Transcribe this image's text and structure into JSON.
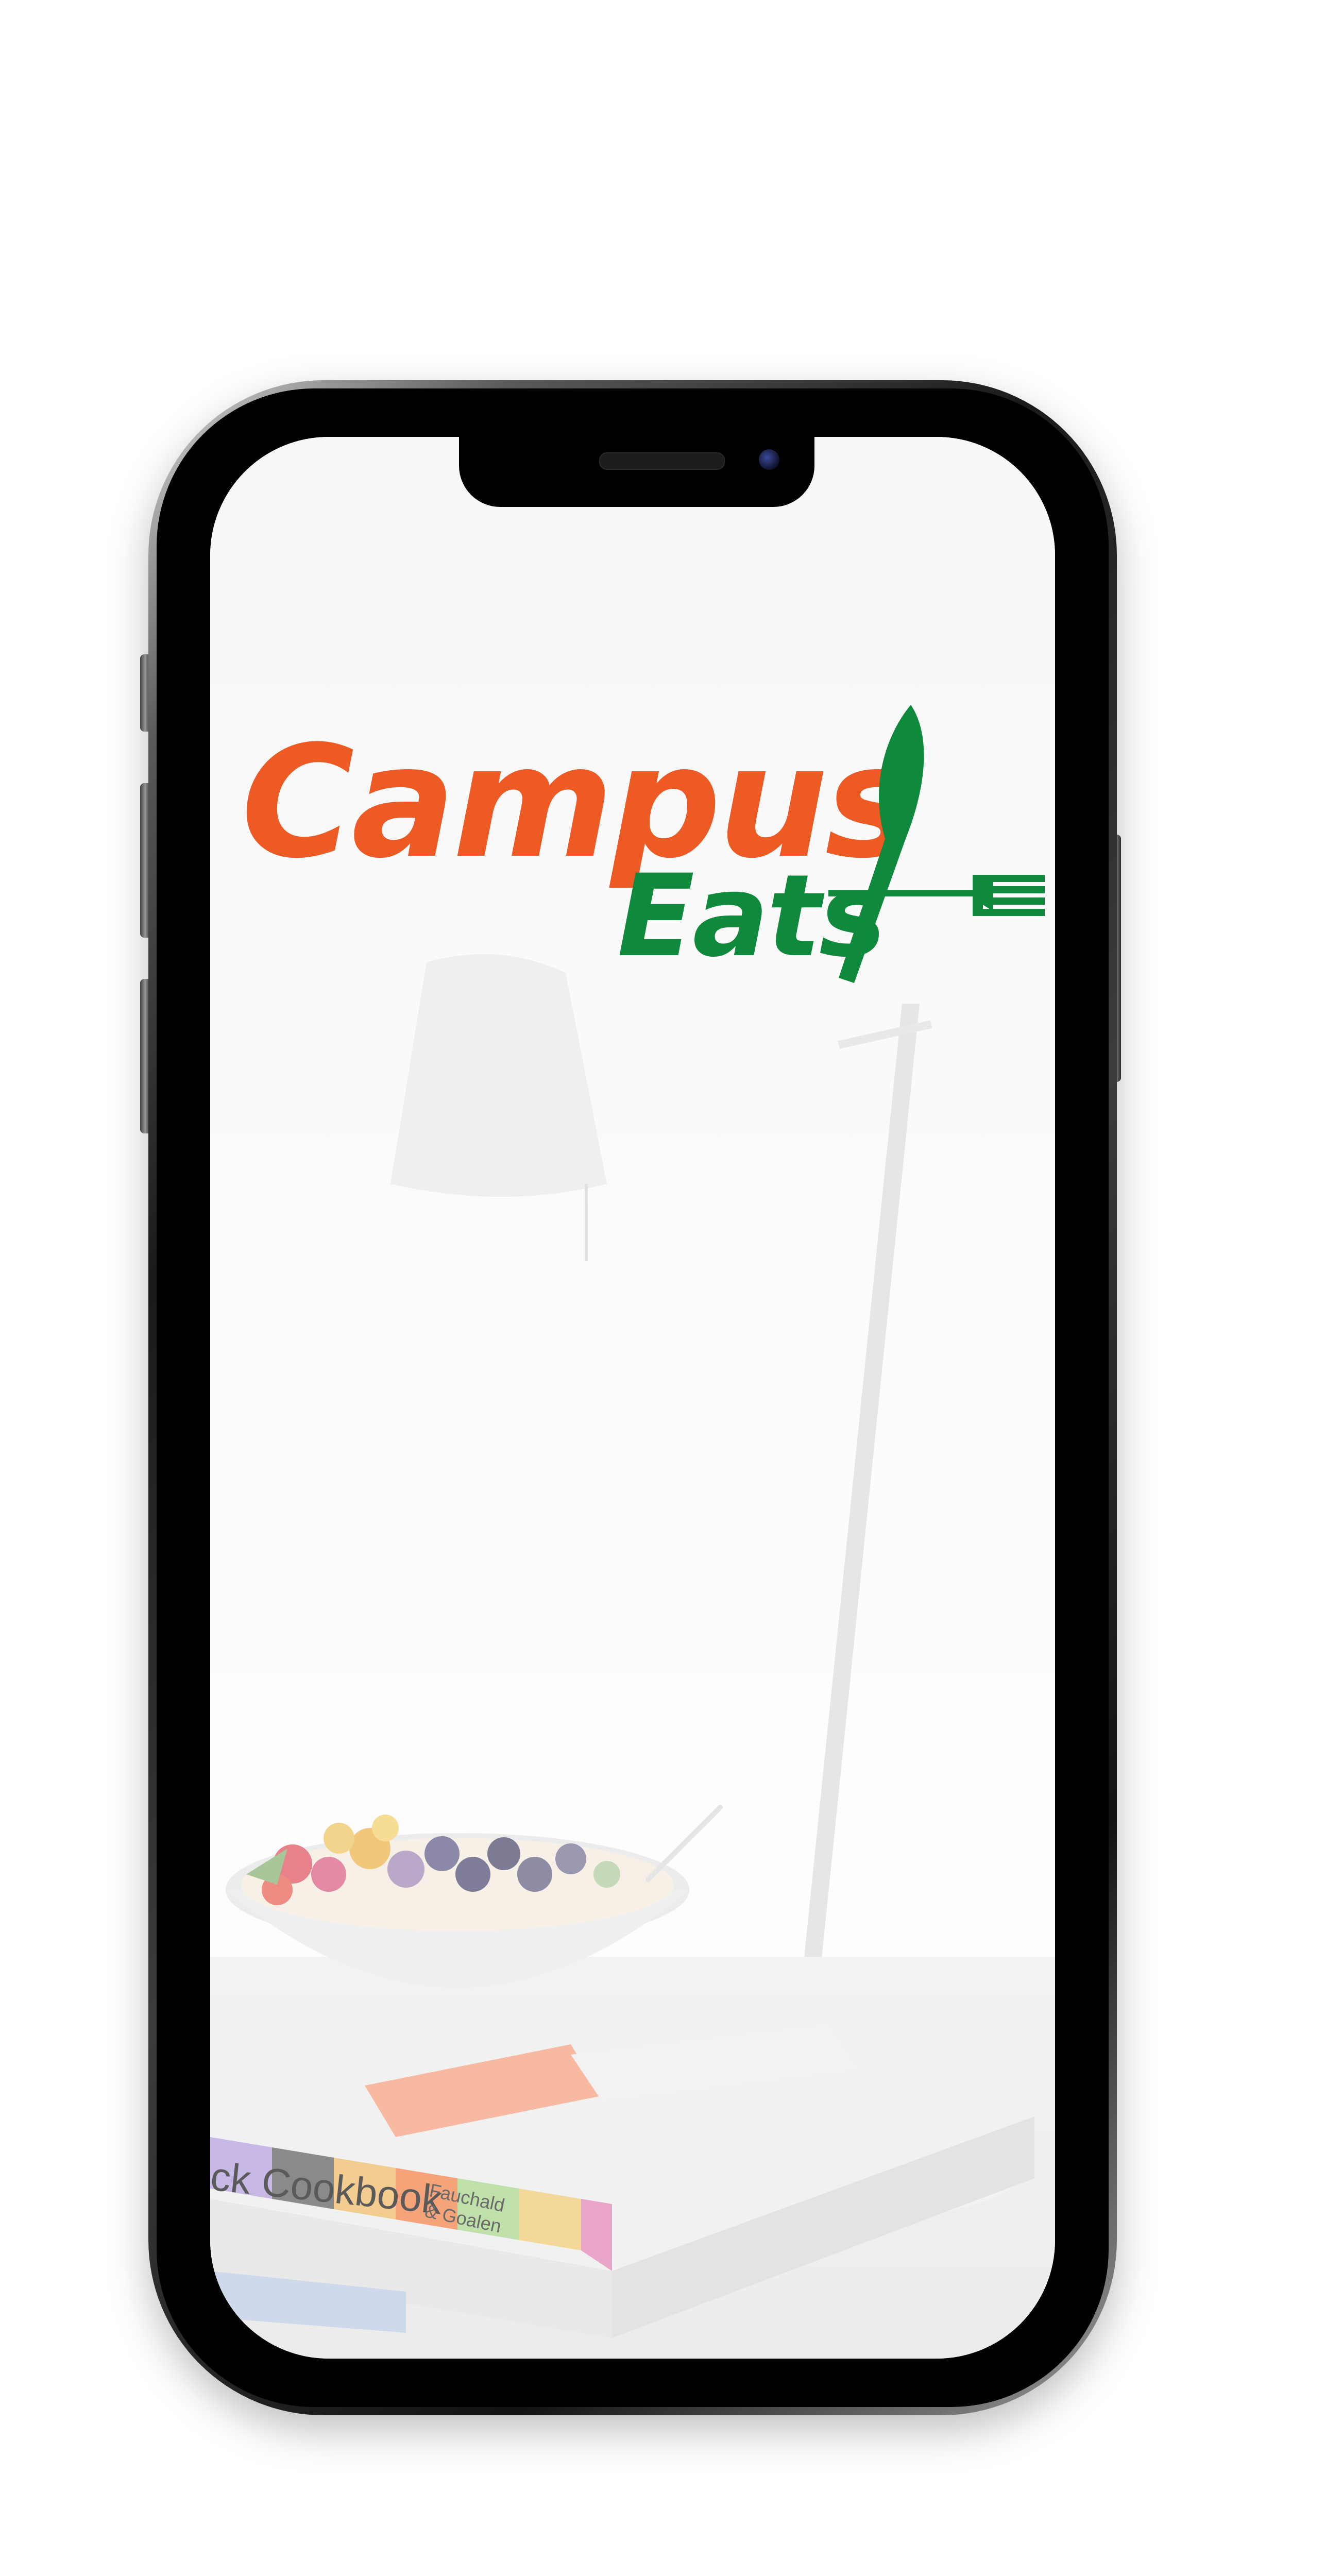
{
  "app": {
    "name_line1": "Campus",
    "name_line2": "Eats"
  },
  "logo": {
    "icon": "knife-fork-icon",
    "primary_color": "#ee5a24",
    "secondary_color": "#0f8a3c"
  },
  "background": {
    "book_spine_text": "ck Cookbook",
    "book_authors": "Fauchald & Goalen"
  },
  "device": {
    "type": "phone-mockup"
  }
}
